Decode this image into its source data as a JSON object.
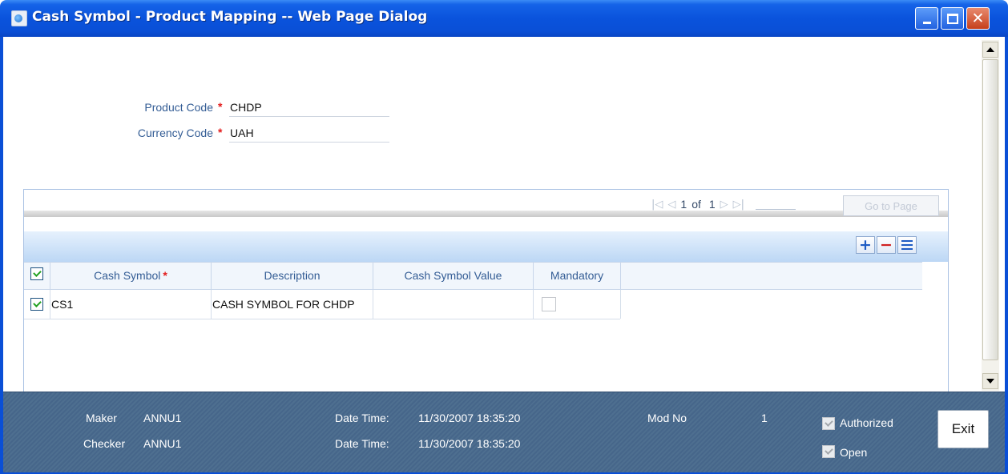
{
  "window": {
    "title": "Cash Symbol - Product Mapping -- Web Page Dialog",
    "minimize_icon": "minimize-icon",
    "maximize_icon": "maximize-icon",
    "close_glyph": "✕"
  },
  "header": {
    "product_code_label": "Product Code",
    "product_code_value": "CHDP",
    "currency_code_label": "Currency Code",
    "currency_code_value": "UAH",
    "required_mark": "*"
  },
  "pager": {
    "first_icon": "first-page-icon",
    "prev_icon": "previous-page-icon",
    "current_page": "1",
    "of_label": "of",
    "total_pages": "1",
    "next_icon": "next-page-icon",
    "last_icon": "last-page-icon",
    "goto_label": "Go to Page"
  },
  "grid_toolbar": {
    "add_glyph": "+",
    "delete_glyph": "−",
    "single_view_icon": "single-view-icon"
  },
  "grid": {
    "columns": [
      {
        "label": "Cash Symbol",
        "required": true
      },
      {
        "label": "Description"
      },
      {
        "label": "Cash Symbol Value"
      },
      {
        "label": "Mandatory"
      }
    ],
    "header_checkbox_checked": true,
    "rows": [
      {
        "selected": true,
        "cash_symbol": "CS1",
        "description": "CASH SYMBOL FOR CHDP",
        "cash_symbol_value": "",
        "mandatory": false
      }
    ]
  },
  "footer": {
    "maker_label": "Maker",
    "maker_value": "ANNU1",
    "checker_label": "Checker",
    "checker_value": "ANNU1",
    "maker_datetime_label": "Date Time:",
    "maker_datetime_value": "11/30/2007 18:35:20",
    "checker_datetime_label": "Date Time:",
    "checker_datetime_value": "11/30/2007 18:35:20",
    "mod_no_label": "Mod No",
    "mod_no_value": "1",
    "authorized_label": "Authorized",
    "authorized_checked": true,
    "open_label": "Open",
    "open_checked": true,
    "exit_label": "Exit"
  },
  "colors": {
    "titlebar": "#0a53dc",
    "label_text": "#345d95",
    "required_mark": "#e31b1b",
    "footer_bg": "#4e6f90",
    "toolbar_band": "#bcd7f5"
  }
}
